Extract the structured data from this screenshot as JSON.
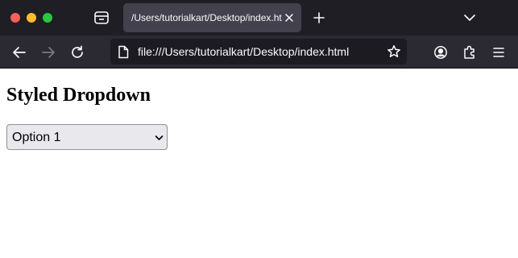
{
  "window": {
    "tab_title": "/Users/tutorialkart/Desktop/index.html"
  },
  "toolbar": {
    "url": "file:///Users/tutorialkart/Desktop/index.html"
  },
  "page": {
    "heading": "Styled Dropdown",
    "dropdown": {
      "selected": "Option 1"
    }
  },
  "colors": {
    "titlebar_bg": "#1f1e25",
    "navbar_bg": "#2b2a33",
    "active_tab_bg": "#42414d",
    "urlbar_bg": "#1c1b22",
    "dropdown_bg": "#e9e9ed"
  },
  "icons": {
    "window_controls": [
      "close-icon",
      "minimize-icon",
      "zoom-icon"
    ],
    "toolbar": [
      "tab-manager-icon",
      "new-tab-icon",
      "list-all-tabs-icon",
      "back-icon",
      "forward-icon",
      "reload-icon",
      "page-icon",
      "bookmark-star-icon",
      "account-icon",
      "extensions-icon",
      "menu-icon"
    ]
  }
}
